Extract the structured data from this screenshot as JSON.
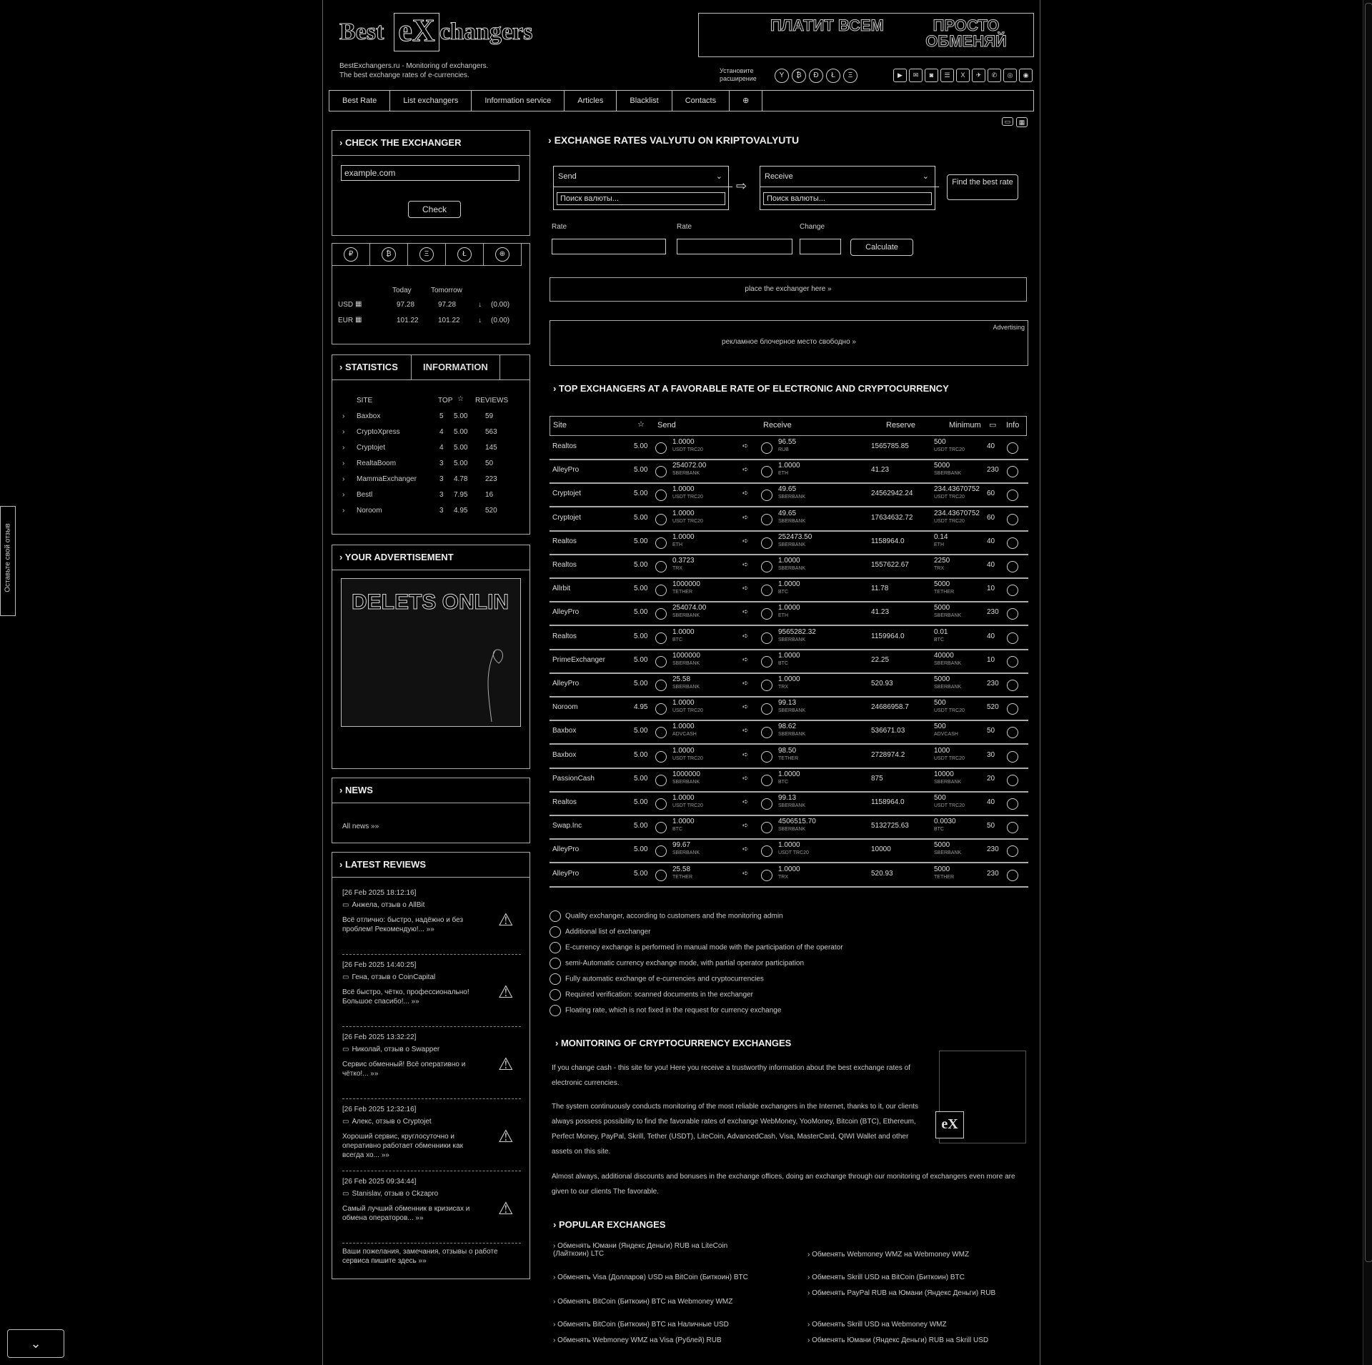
{
  "header": {
    "logo_best": "Best",
    "logo_ex": "eX",
    "logo_changers": "changers",
    "tagline_1": "BestExchangers.ru - Monitoring of exchangers.",
    "tagline_2": "The best exchange rates of e-currencies.",
    "banner_left": "ПЛАТИТ ВСЕМ",
    "banner_right": "ПРОСТО ОБМЕНЯЙ",
    "accept_label": "Установите расширение",
    "pay_icons": [
      "Y",
      "₿",
      "Ð",
      "Ł",
      "Ξ"
    ],
    "social_icons": [
      "▶",
      "✉",
      "◙",
      "☰",
      "X",
      "✈",
      "✆",
      "◎",
      "◉"
    ]
  },
  "nav": {
    "items": [
      "Best Rate",
      "List exchangers",
      "Information service",
      "Articles",
      "Blacklist",
      "Contacts",
      "⊕"
    ]
  },
  "check": {
    "title": "Check the exchanger",
    "input_value": "example.com",
    "button": "Check"
  },
  "currency": {
    "tabs": [
      "₽",
      "₿",
      "Ξ",
      "Ł",
      "⊕"
    ],
    "col_today": "Today",
    "col_tomorrow": "Tomorrow",
    "rows": [
      {
        "code": "USD",
        "today": "97.28",
        "tomorrow": "97.28",
        "arrow": "↓",
        "change": "(0.00)"
      },
      {
        "code": "EUR",
        "today": "101.22",
        "tomorrow": "101.22",
        "arrow": "↓",
        "change": "(0.00)"
      }
    ]
  },
  "stats": {
    "tab_stats": "Statistics",
    "tab_info": "Information",
    "col_site": "SITE",
    "col_top": "TOP",
    "col_reviews": "REVIEWS",
    "rows": [
      {
        "site": "Baxbox",
        "top": "5",
        "rating": "5.00",
        "reviews": "59"
      },
      {
        "site": "CryptoXpress",
        "top": "4",
        "rating": "5.00",
        "reviews": "563"
      },
      {
        "site": "Cryptojet",
        "top": "4",
        "rating": "5.00",
        "reviews": "145"
      },
      {
        "site": "RealtaBoom",
        "top": "3",
        "rating": "5.00",
        "reviews": "50"
      },
      {
        "site": "MammaExchanger",
        "top": "3",
        "rating": "4.78",
        "reviews": "223"
      },
      {
        "site": "Bestl",
        "top": "3",
        "rating": "7.95",
        "reviews": "16"
      },
      {
        "site": "Noroom",
        "top": "3",
        "rating": "4.95",
        "reviews": "520"
      }
    ]
  },
  "ad": {
    "title": "Your advertisement",
    "image_text": "DELETS ONLIN"
  },
  "news": {
    "title": "News",
    "all_link": "All news »»"
  },
  "reviews": {
    "title": "Latest reviews",
    "items": [
      {
        "date": "[26 Feb 2025 18:12:16]",
        "author": "Анжела, отзыв о AllBit",
        "text": "Всё отлично: быстро, надёжно и без проблем! Рекомендую!... »»"
      },
      {
        "date": "[26 Feb 2025 14:40:25]",
        "author": "Гена, отзыв о CoinCapital",
        "text": "Всё быстро, чётко, профессионально! Большое спасибо!... »»"
      },
      {
        "date": "[26 Feb 2025 13:32:22]",
        "author": "Николай, отзыв о Swapper",
        "text": "Сервис обменный! Всё оперативно и чётко!... »»"
      },
      {
        "date": "[26 Feb 2025 12:32:16]",
        "author": "Алекс, отзыв о Cryptojet",
        "text": "Хороший сервис, круглосуточно и оперативно работает обменники как всегда хо... »»"
      },
      {
        "date": "[26 Feb 2025 09:34:44]",
        "author": "Stanislav, отзыв о Ckzapro",
        "text": "Самый лучший обменник в кризисах и обмена операторов... »»"
      }
    ],
    "footer": "Ваши пожелания, замечания, отзывы о работе сервиса пишите здесь »»"
  },
  "exchange": {
    "title": "Exchange rates Valyutu on Kriptovalyutu",
    "send_label": "Send",
    "receive_label": "Receive",
    "search_placeholder_1": "Поиск валюты...",
    "search_placeholder_2": "Поиск валюты...",
    "find_button": "Find the best rate",
    "rate_label_1": "Rate",
    "rate_label_2": "Rate",
    "change_label": "Change",
    "calc_button": "Calculate",
    "place_link": "place the exchanger here »",
    "advertising": "Advertising",
    "ad_link": "рекламное блочерное место свободно »"
  },
  "top": {
    "title": "Top exchangers at a favorable rate of electronic and cryptocurrency",
    "headers": {
      "site": "Site",
      "send": "Send",
      "receive": "Receive",
      "reserve": "Reserve",
      "minimum": "Minimum",
      "info": "Info"
    },
    "rows": [
      {
        "site": "Realtos",
        "rating": "5.00",
        "send": "1.0000",
        "send_cur": "USDT TRC20",
        "recv": "96.55",
        "recv_cur": "RUB",
        "reserve": "1565785.85",
        "minimum": "500",
        "min_cur": "USDT TRC20",
        "rev": "40"
      },
      {
        "site": "AlleyPro",
        "rating": "5.00",
        "send": "254072.00",
        "send_cur": "SBERBANK",
        "recv": "1.0000",
        "recv_cur": "ETH",
        "reserve": "41.23",
        "minimum": "5000",
        "min_cur": "SBERBANK",
        "rev": "230"
      },
      {
        "site": "Cryptojet",
        "rating": "5.00",
        "send": "1.0000",
        "send_cur": "USDT TRC20",
        "recv": "49.65",
        "recv_cur": "SBERBANK",
        "reserve": "24562942.24",
        "minimum": "234.43670752",
        "min_cur": "USDT TRC20",
        "rev": "60"
      },
      {
        "site": "Cryptojet",
        "rating": "5.00",
        "send": "1.0000",
        "send_cur": "USDT TRC20",
        "recv": "49.65",
        "recv_cur": "SBERBANK",
        "reserve": "17634632.72",
        "minimum": "234.43670752",
        "min_cur": "USDT TRC20",
        "rev": "60"
      },
      {
        "site": "Realtos",
        "rating": "5.00",
        "send": "1.0000",
        "send_cur": "ETH",
        "recv": "252473.50",
        "recv_cur": "SBERBANK",
        "reserve": "1158964.0",
        "minimum": "0.14",
        "min_cur": "ETH",
        "rev": "40"
      },
      {
        "site": "Realtos",
        "rating": "5.00",
        "send": "0.3723",
        "send_cur": "TRX",
        "recv": "1.0000",
        "recv_cur": "SBERBANK",
        "reserve": "1557622.67",
        "minimum": "2250",
        "min_cur": "TRX",
        "rev": "40"
      },
      {
        "site": "Allrbit",
        "rating": "5.00",
        "send": "1000000",
        "send_cur": "TETHER",
        "recv": "1.0000",
        "recv_cur": "BTC",
        "reserve": "11.78",
        "minimum": "5000",
        "min_cur": "TETHER",
        "rev": "10"
      },
      {
        "site": "AlleyPro",
        "rating": "5.00",
        "send": "254074.00",
        "send_cur": "SBERBANK",
        "recv": "1.0000",
        "recv_cur": "ETH",
        "reserve": "41.23",
        "minimum": "5000",
        "min_cur": "SBERBANK",
        "rev": "230"
      },
      {
        "site": "Realtos",
        "rating": "5.00",
        "send": "1.0000",
        "send_cur": "BTC",
        "recv": "9565282.32",
        "recv_cur": "SBERBANK",
        "reserve": "1159964.0",
        "minimum": "0.01",
        "min_cur": "BTC",
        "rev": "40"
      },
      {
        "site": "PrimeExchanger",
        "rating": "5.00",
        "send": "1000000",
        "send_cur": "SBERBANK",
        "recv": "1.0000",
        "recv_cur": "BTC",
        "reserve": "22.25",
        "minimum": "40000",
        "min_cur": "SBERBANK",
        "rev": "10"
      },
      {
        "site": "AlleyPro",
        "rating": "5.00",
        "send": "25.58",
        "send_cur": "SBERBANK",
        "recv": "1.0000",
        "recv_cur": "TRX",
        "reserve": "520.93",
        "minimum": "5000",
        "min_cur": "SBERBANK",
        "rev": "230"
      },
      {
        "site": "Noroom",
        "rating": "4.95",
        "send": "1.0000",
        "send_cur": "USDT TRC20",
        "recv": "99.13",
        "recv_cur": "SBERBANK",
        "reserve": "24686958.7",
        "minimum": "500",
        "min_cur": "USDT TRC20",
        "rev": "520"
      },
      {
        "site": "Baxbox",
        "rating": "5.00",
        "send": "1.0000",
        "send_cur": "ADVCASH",
        "recv": "98.62",
        "recv_cur": "SBERBANK",
        "reserve": "536671.03",
        "minimum": "500",
        "min_cur": "ADVCASH",
        "rev": "50"
      },
      {
        "site": "Baxbox",
        "rating": "5.00",
        "send": "1.0000",
        "send_cur": "USDT TRC20",
        "recv": "98.50",
        "recv_cur": "TETHER",
        "reserve": "2728974.2",
        "minimum": "1000",
        "min_cur": "USDT TRC20",
        "rev": "30"
      },
      {
        "site": "PassionCash",
        "rating": "5.00",
        "send": "1000000",
        "send_cur": "SBERBANK",
        "recv": "1.0000",
        "recv_cur": "BTC",
        "reserve": "875",
        "minimum": "10000",
        "min_cur": "SBERBANK",
        "rev": "20"
      },
      {
        "site": "Realtos",
        "rating": "5.00",
        "send": "1.0000",
        "send_cur": "USDT TRC20",
        "recv": "99.13",
        "recv_cur": "SBERBANK",
        "reserve": "1158964.0",
        "minimum": "500",
        "min_cur": "USDT TRC20",
        "rev": "40"
      },
      {
        "site": "Swap.Inc",
        "rating": "5.00",
        "send": "1.0000",
        "send_cur": "BTC",
        "recv": "4506515.70",
        "recv_cur": "SBERBANK",
        "reserve": "5132725.63",
        "minimum": "0.0030",
        "min_cur": "BTC",
        "rev": "50"
      },
      {
        "site": "AlleyPro",
        "rating": "5.00",
        "send": "99.67",
        "send_cur": "SBERBANK",
        "recv": "1.0000",
        "recv_cur": "USDT TRC20",
        "reserve": "10000",
        "minimum": "5000",
        "min_cur": "SBERBANK",
        "rev": "230"
      },
      {
        "site": "AlleyPro",
        "rating": "5.00",
        "send": "25.58",
        "send_cur": "TETHER",
        "recv": "1.0000",
        "recv_cur": "TRX",
        "reserve": "520.93",
        "minimum": "5000",
        "min_cur": "TETHER",
        "rev": "230"
      }
    ]
  },
  "legend": [
    "Quality exchanger, according to customers and the monitoring admin",
    "Additional list of exchanger",
    "E-currency exchange is performed in manual mode with the participation of the operator",
    "semi-Automatic currency exchange mode, with partial operator participation",
    "Fully automatic exchange of e-currencies and cryptocurrencies",
    "Required verification: scanned documents in the exchanger",
    "Floating rate, which is not fixed in the request for currency exchange"
  ],
  "monitoring": {
    "title": "Monitoring of cryptocurrency exchanges",
    "p1": "If you change cash - this site for you! Here you receive a trustworthy information about the best exchange rates of electronic currencies.",
    "p2": "The system continuously conducts monitoring of the most reliable exchangers in the Internet, thanks to it, our clients always possess possibility to find the favorable rates of exchange WebMoney, YooMoney, Bitcoin (BTC), Ethereum, Perfect Money, PayPal, Skrill, Tether (USDT), LiteCoin, AdvancedCash, Visa, MasterCard, QIWI Wallet and other assets on this site.",
    "p3": "Almost always, additional discounts and bonuses in the exchange offices, doing an exchange through our monitoring of exchangers even more are given to our clients The favorable."
  },
  "popular": {
    "title": "Popular exchanges",
    "left": [
      "Обменять Юмани (Яндекс Деньги) RUB на LiteCoin (Лайткоин) LTC",
      "Обменять Visa (Долларов) USD на BitCoin (Биткоин) BTC",
      "Обменять BitCoin (Биткоин) BTC на Webmoney WMZ",
      "Обменять BitCoin (Биткоин) BTC на Наличные USD",
      "Обменять Webmoney WMZ на Visa (Рублей) RUB"
    ],
    "right": [
      "Обменять Webmoney WMZ на Webmoney WMZ",
      "Обменять Skrill USD на BitCoin (Биткоин) BTC",
      "Обменять PayPal RUB на Юмани (Яндекс Деньги) RUB",
      "Обменять Skrill USD на Webmoney WMZ",
      "Обменять Юмани (Яндекс Деньги) RUB на Skrill USD"
    ]
  },
  "side_tab": "Оставьте свой отзыв"
}
